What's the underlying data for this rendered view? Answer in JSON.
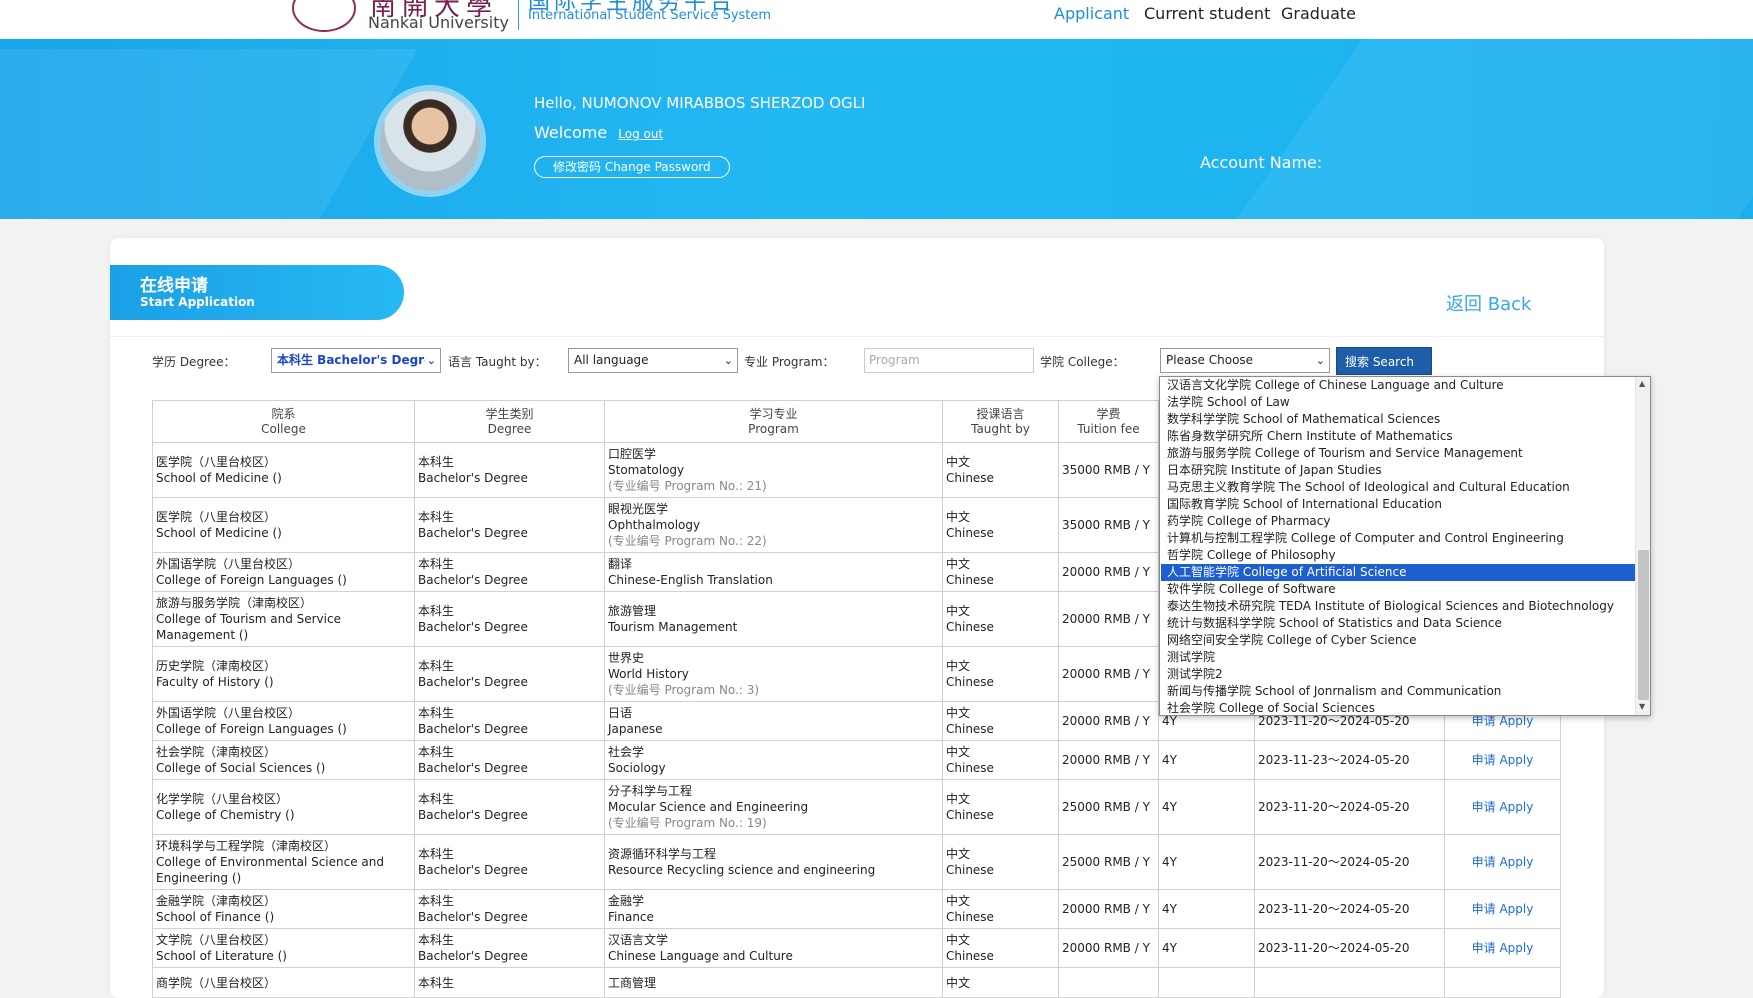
{
  "header": {
    "university_cn": "南開大學",
    "university_en": "Nankai University",
    "system_cn": "国际学生服务平台",
    "system_en": "International Student Service System",
    "nav": [
      "Applicant",
      "Current student",
      "Graduate"
    ]
  },
  "banner": {
    "hello": "Hello,  NUMONOV MIRABBOS SHERZOD OGLI",
    "welcome": "Welcome",
    "logout": "Log out",
    "change_password": "修改密码 Change Password",
    "account_name": "Account Name:"
  },
  "page": {
    "tab_cn": "在线申请",
    "tab_en": "Start Application",
    "back": "返回 Back"
  },
  "filters": {
    "degree_label": "学历 Degree：",
    "degree_value": "本科生 Bachelor's Degree",
    "taught_label": "语言 Taught by：",
    "taught_value": "All language",
    "program_label": "专业 Program：",
    "program_placeholder": "Program",
    "college_label": "学院 College：",
    "college_value": "Please Choose",
    "search": "搜索 Search"
  },
  "college_options": [
    "汉语言文化学院 College of Chinese Language and Culture",
    "法学院 School of Law",
    "数学科学学院 School of Mathematical Sciences",
    "陈省身数学研究所 Chern Institute of Mathematics",
    "旅游与服务学院 College of Tourism and Service Management",
    "日本研究院 Institute of Japan Studies",
    "马克思主义教育学院 The School of Ideological and Cultural Education",
    "国际教育学院 School of International Education",
    "药学院 College of Pharmacy",
    "计算机与控制工程学院 College of Computer and Control Engineering",
    "哲学院 College of Philosophy",
    "人工智能学院 College of Artificial Science",
    "软件学院 College of Software",
    "泰达生物技术研究院 TEDA Institute of Biological Sciences and Biotechnology",
    "统计与数据科学学院 School of Statistics and Data Science",
    "网络空间安全学院 College of Cyber Science",
    "测试学院",
    "测试学院2",
    "新闻与传播学院 School of Jonrnalism and Communication",
    "社会学院 College of Social Sciences"
  ],
  "selected_option_index": 11,
  "table": {
    "headers": [
      {
        "cn": "院系",
        "en": "College"
      },
      {
        "cn": "学生类别",
        "en": "Degree"
      },
      {
        "cn": "学习专业",
        "en": "Program"
      },
      {
        "cn": "授课语言",
        "en": "Taught by"
      },
      {
        "cn": "学费",
        "en": "Tuition fee"
      }
    ],
    "rows": [
      {
        "college_cn": "医学院（八里台校区）",
        "college_en": "School of Medicine  ()",
        "degree_cn": "本科生",
        "degree_en": "Bachelor's Degree",
        "program_cn": "口腔医学",
        "program_en": "Stomatology",
        "program_no": "(专业编号 Program No.: 21)",
        "lang_cn": "中文",
        "lang_en": "Chinese",
        "fee": "35000 RMB / Y",
        "duration": "",
        "period": "",
        "apply": ""
      },
      {
        "college_cn": "医学院（八里台校区）",
        "college_en": "School of Medicine  ()",
        "degree_cn": "本科生",
        "degree_en": "Bachelor's Degree",
        "program_cn": "眼视光医学",
        "program_en": "Ophthalmology",
        "program_no": "(专业编号 Program No.: 22)",
        "lang_cn": "中文",
        "lang_en": "Chinese",
        "fee": "35000 RMB / Y",
        "duration": "",
        "period": "",
        "apply": ""
      },
      {
        "college_cn": "外国语学院（八里台校区）",
        "college_en": "College of Foreign Languages  ()",
        "degree_cn": "本科生",
        "degree_en": "Bachelor's Degree",
        "program_cn": "翻译",
        "program_en": "Chinese-English Translation",
        "program_no": "",
        "lang_cn": "中文",
        "lang_en": "Chinese",
        "fee": "20000 RMB / Y",
        "duration": "",
        "period": "",
        "apply": ""
      },
      {
        "college_cn": "旅游与服务学院（津南校区）",
        "college_en": "College of Tourism and Service Management  ()",
        "degree_cn": "本科生",
        "degree_en": "Bachelor's Degree",
        "program_cn": "旅游管理",
        "program_en": "Tourism Management",
        "program_no": "",
        "lang_cn": "中文",
        "lang_en": "Chinese",
        "fee": "20000 RMB / Y",
        "duration": "",
        "period": "",
        "apply": ""
      },
      {
        "college_cn": "历史学院（津南校区）",
        "college_en": "Faculty of History  ()",
        "degree_cn": "本科生",
        "degree_en": "Bachelor's Degree",
        "program_cn": "世界史",
        "program_en": "World History",
        "program_no": "(专业编号 Program No.: 3)",
        "lang_cn": "中文",
        "lang_en": "Chinese",
        "fee": "20000 RMB / Y",
        "duration": "",
        "period": "",
        "apply": ""
      },
      {
        "college_cn": "外国语学院（八里台校区）",
        "college_en": "College of Foreign Languages  ()",
        "degree_cn": "本科生",
        "degree_en": "Bachelor's Degree",
        "program_cn": "日语",
        "program_en": "Japanese",
        "program_no": "",
        "lang_cn": "中文",
        "lang_en": "Chinese",
        "fee": "20000 RMB / Y",
        "duration": "4Y",
        "period": "2023-11-20～2024-05-20",
        "apply": "申请 Apply"
      },
      {
        "college_cn": "社会学院（津南校区）",
        "college_en": "College of Social Sciences  ()",
        "degree_cn": "本科生",
        "degree_en": "Bachelor's Degree",
        "program_cn": "社会学",
        "program_en": "Sociology",
        "program_no": "",
        "lang_cn": "中文",
        "lang_en": "Chinese",
        "fee": "20000 RMB / Y",
        "duration": "4Y",
        "period": "2023-11-23～2024-05-20",
        "apply": "申请 Apply"
      },
      {
        "college_cn": "化学学院（八里台校区）",
        "college_en": "College of Chemistry  ()",
        "degree_cn": "本科生",
        "degree_en": "Bachelor's Degree",
        "program_cn": "分子科学与工程",
        "program_en": "Mocular Science and Engineering",
        "program_no": "(专业编号 Program No.: 19)",
        "lang_cn": "中文",
        "lang_en": "Chinese",
        "fee": "25000 RMB / Y",
        "duration": "4Y",
        "period": "2023-11-20～2024-05-20",
        "apply": "申请 Apply"
      },
      {
        "college_cn": "环境科学与工程学院（津南校区）",
        "college_en": "College of Environmental Science and Engineering  ()",
        "degree_cn": "本科生",
        "degree_en": "Bachelor's Degree",
        "program_cn": "资源循环科学与工程",
        "program_en": "Resource Recycling science and engineering",
        "program_no": "",
        "lang_cn": "中文",
        "lang_en": "Chinese",
        "fee": "25000 RMB / Y",
        "duration": "4Y",
        "period": "2023-11-20～2024-05-20",
        "apply": "申请 Apply"
      },
      {
        "college_cn": "金融学院（津南校区）",
        "college_en": "School of Finance  ()",
        "degree_cn": "本科生",
        "degree_en": "Bachelor's Degree",
        "program_cn": "金融学",
        "program_en": "Finance",
        "program_no": "",
        "lang_cn": "中文",
        "lang_en": "Chinese",
        "fee": "20000 RMB / Y",
        "duration": "4Y",
        "period": "2023-11-20～2024-05-20",
        "apply": "申请 Apply"
      },
      {
        "college_cn": "文学院（八里台校区）",
        "college_en": "School of Literature  ()",
        "degree_cn": "本科生",
        "degree_en": "Bachelor's Degree",
        "program_cn": "汉语言文学",
        "program_en": "Chinese Language and Culture",
        "program_no": "",
        "lang_cn": "中文",
        "lang_en": "Chinese",
        "fee": "20000 RMB / Y",
        "duration": "4Y",
        "period": "2023-11-20～2024-05-20",
        "apply": "申请 Apply"
      },
      {
        "college_cn": "商学院（八里台校区）",
        "college_en": "",
        "degree_cn": "本科生",
        "degree_en": "",
        "program_cn": "工商管理",
        "program_en": "",
        "program_no": "",
        "lang_cn": "中文",
        "lang_en": "",
        "fee": "",
        "duration": "",
        "period": "",
        "apply": ""
      }
    ]
  },
  "colors": {
    "primary_blue": "#1aa6ea",
    "selected_option": "#1e5fd0",
    "apply_link": "#1e6bd6",
    "search_button": "#1e5ea8"
  }
}
